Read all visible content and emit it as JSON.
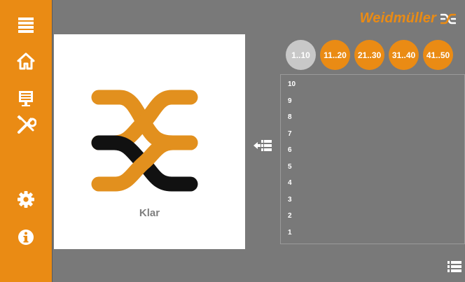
{
  "brand": {
    "name": "Weidmüller",
    "color": "#ea8b14"
  },
  "sidebar": {
    "color": "#ea8b14",
    "items": [
      {
        "name": "menu",
        "icon": "hamburger-menu-icon"
      },
      {
        "name": "home",
        "icon": "home-icon"
      },
      {
        "name": "display",
        "icon": "monitor-icon"
      },
      {
        "name": "tools",
        "icon": "tools-icon"
      },
      {
        "name": "settings",
        "icon": "gear-icon"
      },
      {
        "name": "info",
        "icon": "info-icon"
      }
    ]
  },
  "status": {
    "label": "Klar",
    "icon": "weidmuller-logo-icon"
  },
  "range_buttons": [
    {
      "label": "1..10",
      "active": true
    },
    {
      "label": "11..20",
      "active": false
    },
    {
      "label": "21..30",
      "active": false
    },
    {
      "label": "31..40",
      "active": false
    },
    {
      "label": "41..50",
      "active": false
    }
  ],
  "rows": [
    "10",
    "9",
    "8",
    "7",
    "6",
    "5",
    "4",
    "3",
    "2",
    "1"
  ],
  "icons": {
    "move": "move-to-list-icon",
    "list": "list-icon"
  }
}
